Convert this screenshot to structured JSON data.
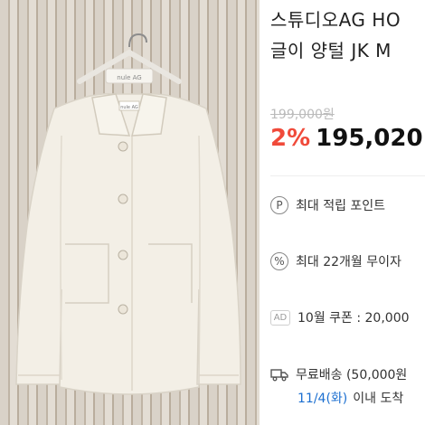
{
  "product": {
    "photo": {
      "hanger_tag": "nule AG",
      "collar_label": "nule AG"
    },
    "title_line1": "스튜디오AG HO",
    "title_line2": "글이 양털 JK M",
    "original_price": "199,000원",
    "sale_rate": "2%",
    "sale_price": "195,020"
  },
  "benefits": [
    {
      "icon": "point-icon",
      "glyph": "P",
      "label": "최대 적립 포인트"
    },
    {
      "icon": "percent-icon",
      "glyph": "%",
      "label": "최대 22개월 무이자"
    },
    {
      "icon": "ad-badge",
      "glyph": "AD",
      "label": "10월 쿠폰 : 20,000"
    }
  ],
  "shipping": {
    "label": "무료배송 (50,000원",
    "arrival_date": "11/4(화)",
    "arrival_text": "이내 도착"
  },
  "colors": {
    "sale_red": "#f04a3a",
    "date_blue": "#1c6fd0",
    "strike_gray": "#bbbbbb"
  }
}
